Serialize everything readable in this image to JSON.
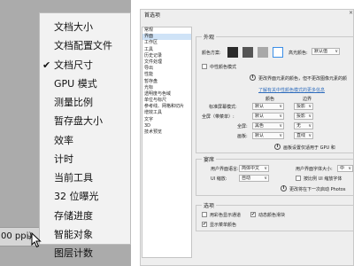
{
  "status_menu": {
    "items": [
      {
        "label": "文档大小",
        "checked": false
      },
      {
        "label": "文档配置文件",
        "checked": false
      },
      {
        "label": "文档尺寸",
        "checked": true
      },
      {
        "label": "GPU 模式",
        "checked": false
      },
      {
        "label": "测量比例",
        "checked": false
      },
      {
        "label": "暂存盘大小",
        "checked": false
      },
      {
        "label": "效率",
        "checked": false
      },
      {
        "label": "计时",
        "checked": false
      },
      {
        "label": "当前工具",
        "checked": false
      },
      {
        "label": "32 位曝光",
        "checked": false
      },
      {
        "label": "存储进度",
        "checked": false
      },
      {
        "label": "智能对象",
        "checked": false
      },
      {
        "label": "图层计数",
        "checked": false
      }
    ],
    "check_mark": "✔"
  },
  "status_bar": {
    "text": "00 ppi)",
    "arrow": ">"
  },
  "dialog": {
    "title": "首选项",
    "close": "×",
    "nav": [
      "常规",
      "界面",
      "工作区",
      "工具",
      "历史记录",
      "文件处理",
      "导出",
      "性能",
      "暂存盘",
      "光标",
      "透明度与色域",
      "单位与标尺",
      "参考线、网格和切片",
      "增效工具",
      "文字",
      "3D",
      "技术预览"
    ],
    "nav_selected_index": 1,
    "appearance": {
      "legend": "外观",
      "color_scheme_label": "颜色方案:",
      "swatch_colors": [
        "#2b2b2b",
        "#555555",
        "#a8a8a8",
        "#ffffff"
      ],
      "highlight_label": "高光颜色:",
      "highlight_value": "默认值",
      "neutral_checkbox": "中性颜色模式",
      "neutral_checked": false,
      "ui_note": "更改界面元素的颜色，但不更改图像元素的颜",
      "learn_link": "了解有关中性颜色模式的更多信息",
      "col_color": "颜色",
      "col_border": "边界",
      "rows": [
        {
          "label": "标准屏幕模式:",
          "color": "默认",
          "border": "投影"
        },
        {
          "label": "全屏（带菜单）:",
          "color": "默认",
          "border": "投影"
        },
        {
          "label": "全屏:",
          "color": "黑色",
          "border": "无"
        },
        {
          "label": "画板:",
          "color": "默认",
          "border": "直线"
        }
      ],
      "gpu_note": "画板设置仅适用于 GPU 和"
    },
    "text_section": {
      "legend": "宴席",
      "ui_lang_label": "用户界面语言:",
      "ui_lang_value": "简体中文",
      "font_size_label": "用户界面字体大小:",
      "font_size_value": "中",
      "ui_scale_label": "UI 缩放:",
      "ui_scale_value": "自动",
      "font_scale_label": "按比例 UI 缩放字体",
      "font_scale_checked": false,
      "restart_note": "更改将在下一次启动 Photos"
    },
    "options": {
      "legend": "选项",
      "items": [
        {
          "label": "用彩色显示通道",
          "checked": false
        },
        {
          "label": "动态颜色滑块",
          "checked": true
        },
        {
          "label": "显示菜单颜色",
          "checked": true
        }
      ]
    }
  }
}
